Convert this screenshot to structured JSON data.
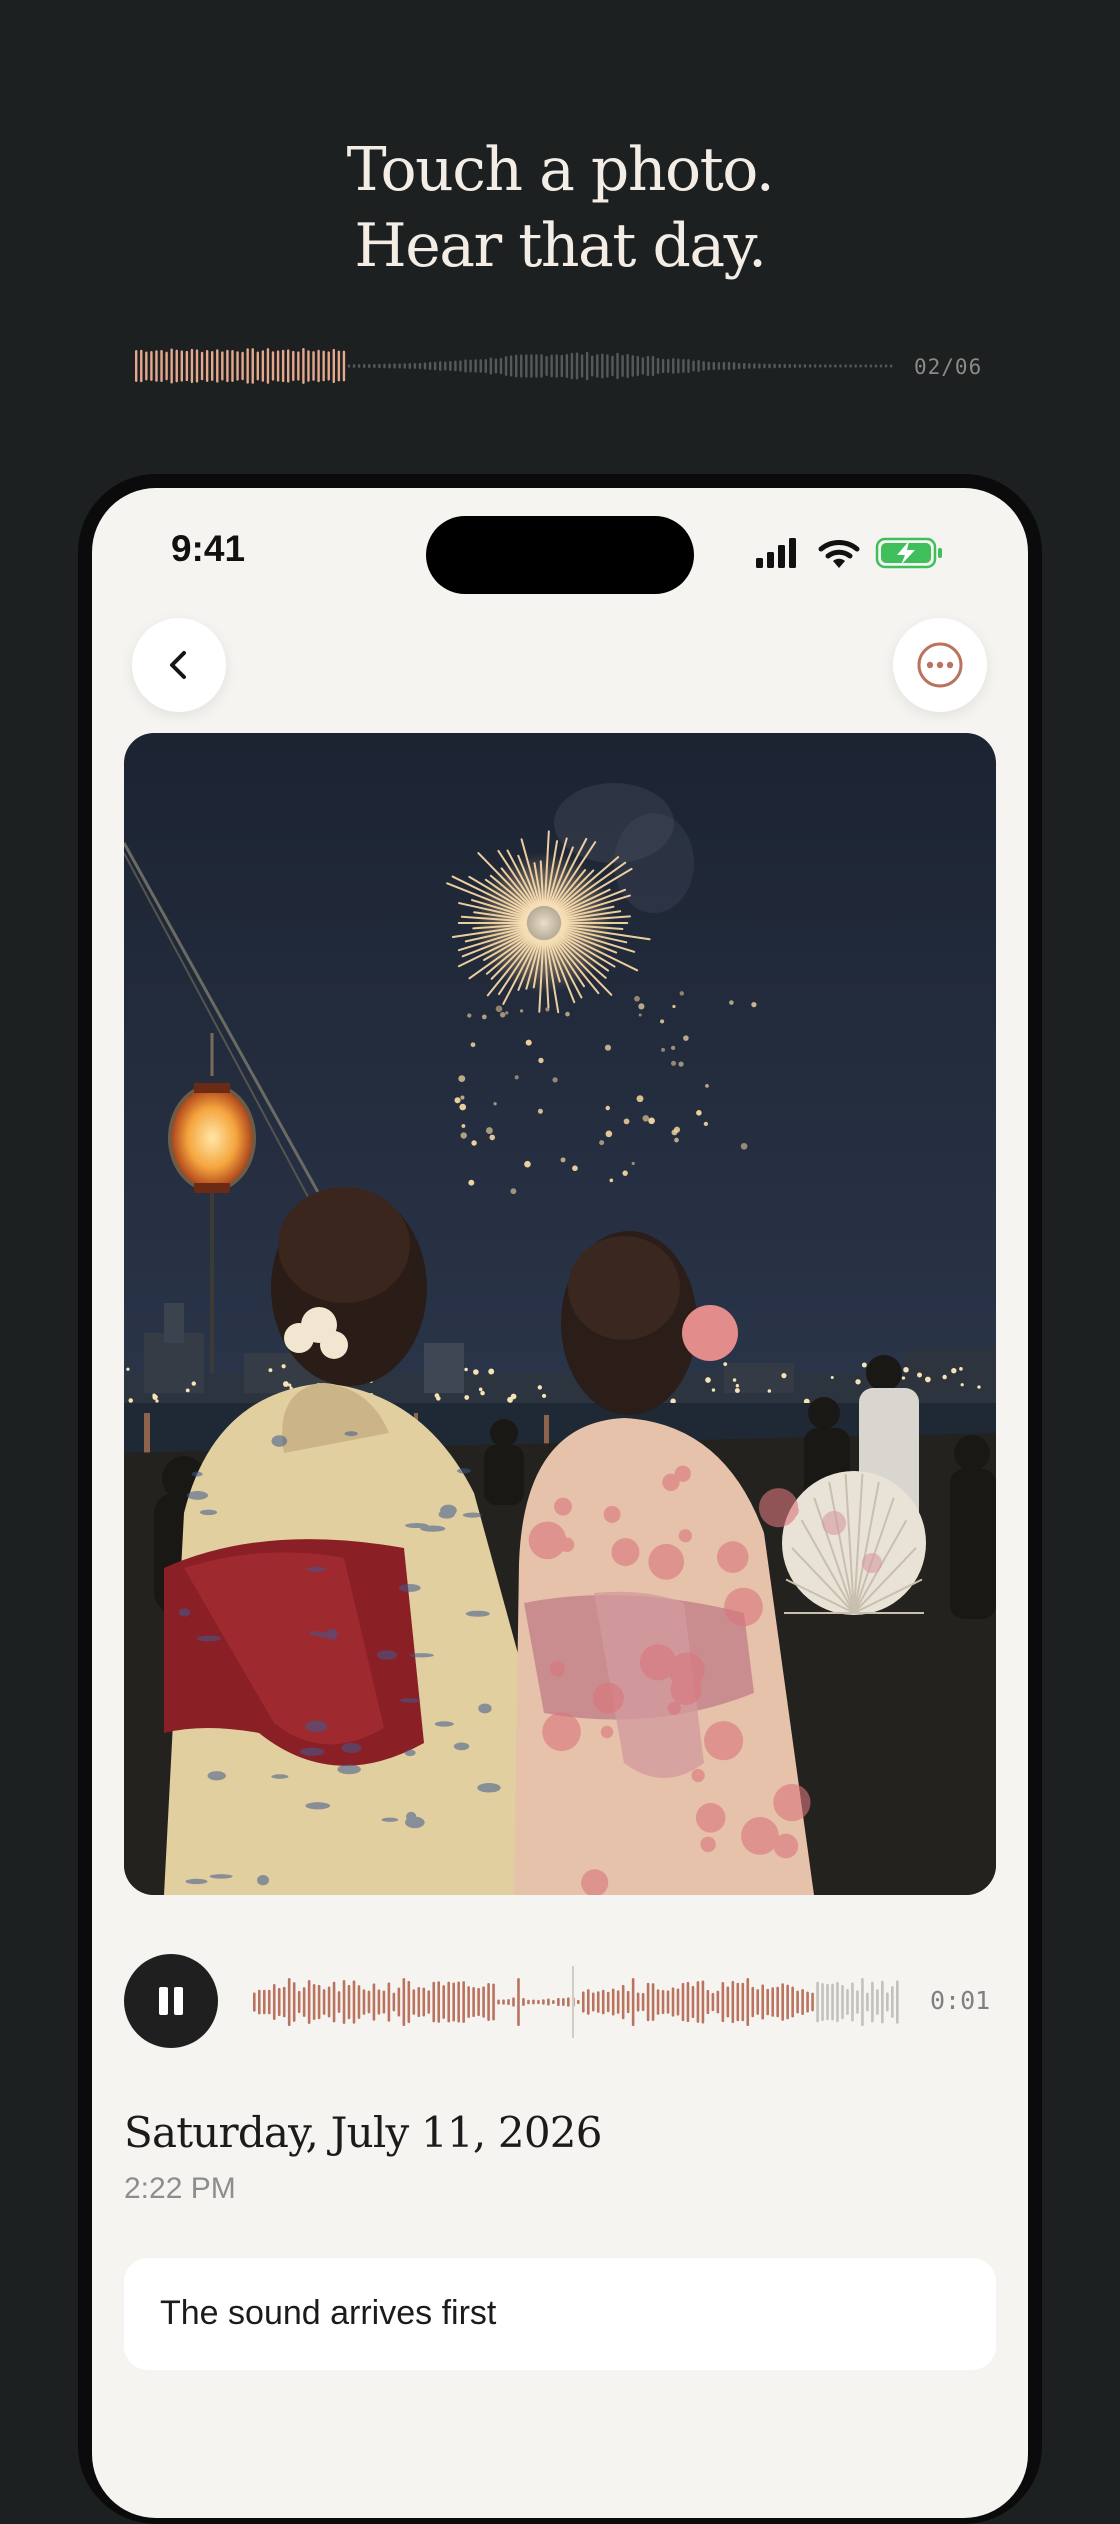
{
  "hero": {
    "line1": "Touch a photo.",
    "line2": "Hear that day.",
    "counter": "02/06",
    "progress": 0.28
  },
  "status_bar": {
    "time": "9:41",
    "icons": [
      "signal-icon",
      "wifi-icon",
      "battery-charging-icon"
    ]
  },
  "nav": {
    "back_icon": "chevron-left-icon",
    "more_icon": "more-horizontal-icon"
  },
  "photo": {
    "subject": "fireworks-festival"
  },
  "player": {
    "state_icon": "pause-icon",
    "elapsed": "0:01",
    "progress": 0.87
  },
  "entry": {
    "date": "Saturday, July 11, 2026",
    "time": "2:22 PM",
    "caption": "The sound arrives first"
  },
  "colors": {
    "background": "#1d2020",
    "accent": "#b9735f",
    "played": "#e6a88d",
    "screen": "#f6f4f0"
  }
}
